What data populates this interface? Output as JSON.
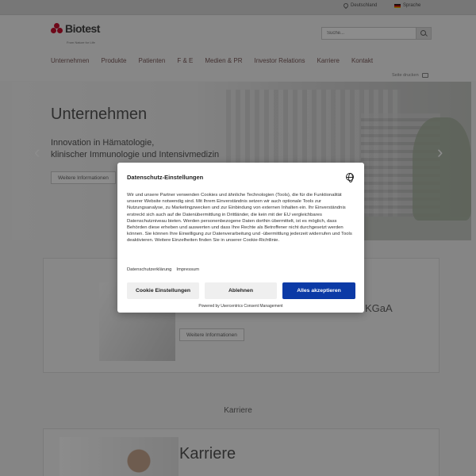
{
  "topbar": {
    "location": "Deutschland",
    "language": "Sprache"
  },
  "header": {
    "logo_name": "Biotest",
    "logo_tagline": "From Nature for Life",
    "search_placeholder": "Suche...",
    "print_label": "Seite drucken"
  },
  "nav": {
    "items": [
      {
        "label": "Unternehmen"
      },
      {
        "label": "Produkte"
      },
      {
        "label": "Patienten"
      },
      {
        "label": "F & E"
      },
      {
        "label": "Medien & PR"
      },
      {
        "label": "Investor Relations"
      },
      {
        "label": "Karriere"
      },
      {
        "label": "Kontakt"
      }
    ]
  },
  "hero": {
    "title": "Unternehmen",
    "subtitle_line1": "Innovation in Hämatologie,",
    "subtitle_line2": "klinischer Immunologie und Intensivmedizin",
    "button": "Weitere Informationen"
  },
  "card1": {
    "title_fragment": "KGaA",
    "button": "Weitere Informationen"
  },
  "karriere_section": {
    "label": "Karriere",
    "card_title": "Karriere"
  },
  "consent": {
    "title": "Datenschutz-Einstellungen",
    "text": "Wir und unsere Partner verwenden Cookies und ähnliche Technologien (Tools), die für die Funktionalität unserer Website notwendig sind. Mit Ihrem Einverständnis setzen wir auch optionale Tools zur Nutzungsanalyse, zu Marketingzwecken und zur Einbindung von externen Inhalten ein. Ihr Einverständnis erstreckt sich auch auf die Datenübermittlung in Drittländer, die kein mit der EU vergleichbares Datenschutzniveau bieten. Werden personenbezogene Daten dorthin übermittelt, ist es möglich, dass Behörden diese erheben und auswerten und dass Ihre Rechte als Betroffener nicht durchgesetzt werden können. Sie können Ihre Einwilligung zur Datenverarbeitung und -übermittlung jederzeit widerrufen und Tools deaktivieren. Weitere Einzelheiten finden Sie in unserer Cookie-Richtlinie.",
    "link_privacy": "Datenschutzerklärung",
    "link_imprint": "Impressum",
    "btn_settings": "Cookie Einstellungen",
    "btn_decline": "Ablehnen",
    "btn_accept": "Alles akzeptieren",
    "powered_by": "Powered by Usercentrics Consent Management"
  },
  "colors": {
    "accept": "#0b3aa6",
    "brand": "#c8102e"
  }
}
